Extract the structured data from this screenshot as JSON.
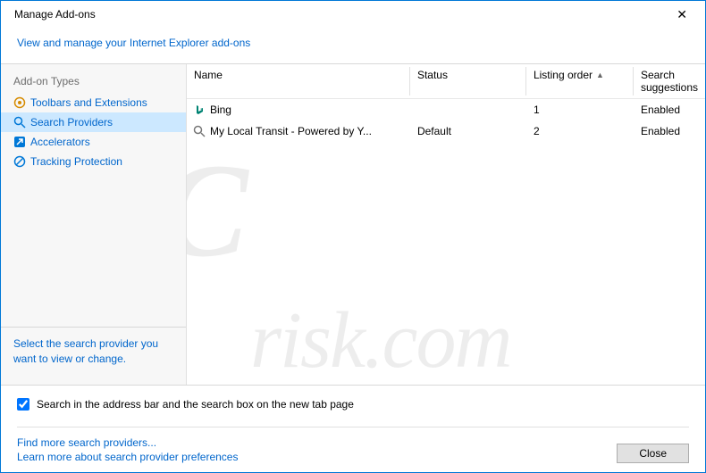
{
  "window": {
    "title": "Manage Add-ons",
    "subtitle_link": "View and manage your Internet Explorer add-ons"
  },
  "sidebar": {
    "header": "Add-on Types",
    "items": [
      {
        "label": "Toolbars and Extensions"
      },
      {
        "label": "Search Providers"
      },
      {
        "label": "Accelerators"
      },
      {
        "label": "Tracking Protection"
      }
    ],
    "hint": "Select the search provider you want to view or change."
  },
  "table": {
    "headers": {
      "name": "Name",
      "status": "Status",
      "order": "Listing order",
      "suggestions": "Search suggestions"
    },
    "rows": [
      {
        "name": "Bing",
        "status": "",
        "order": "1",
        "suggestions": "Enabled"
      },
      {
        "name": "My Local Transit - Powered by Y...",
        "status": "Default",
        "order": "2",
        "suggestions": "Enabled"
      }
    ]
  },
  "bottom": {
    "checkbox_label": "Search in the address bar and the search box on the new tab page",
    "checkbox_checked": true
  },
  "footer": {
    "link1": "Find more search providers...",
    "link2": "Learn more about search provider preferences",
    "close_label": "Close"
  },
  "watermark": {
    "big": "PC",
    "small": "risk.com"
  }
}
